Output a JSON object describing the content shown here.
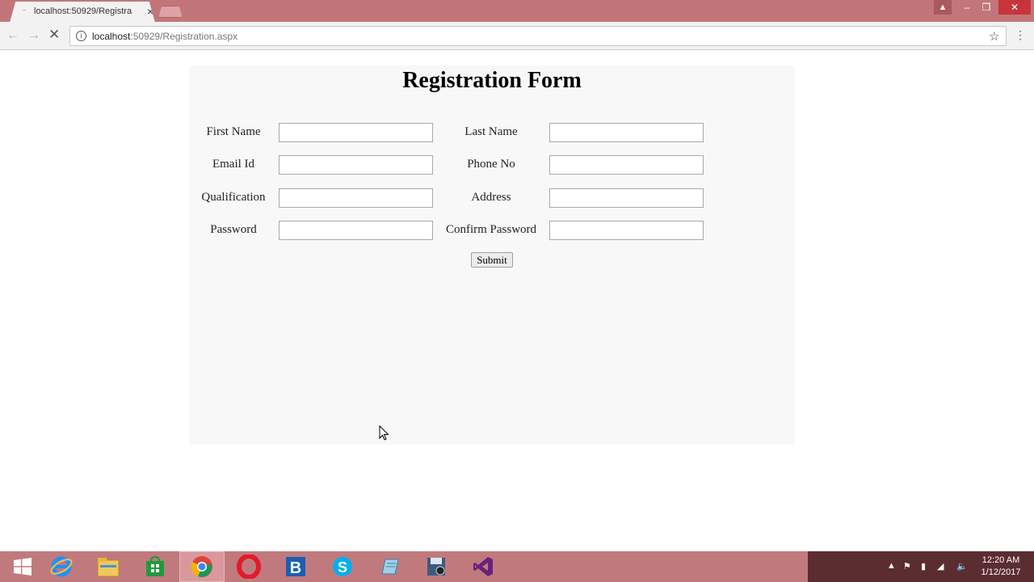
{
  "browser": {
    "tab_title": "localhost:50929/Registra",
    "url_host": "localhost",
    "url_rest": ":50929/Registration.aspx"
  },
  "form": {
    "title": "Registration Form",
    "fields": {
      "first_name": {
        "label": "First Name",
        "value": ""
      },
      "last_name": {
        "label": "Last Name",
        "value": ""
      },
      "email": {
        "label": "Email Id",
        "value": ""
      },
      "phone": {
        "label": "Phone No",
        "value": ""
      },
      "qualification": {
        "label": "Qualification",
        "value": ""
      },
      "address": {
        "label": "Address",
        "value": ""
      },
      "password": {
        "label": "Password",
        "value": ""
      },
      "confirm_password": {
        "label": "Confirm Password",
        "value": ""
      }
    },
    "submit_label": "Submit"
  },
  "taskbar": {
    "apps": [
      "start-icon",
      "internet-explorer-icon",
      "file-explorer-icon",
      "store-icon",
      "chrome-icon",
      "opera-icon",
      "bing-icon",
      "skype-icon",
      "notepad-icon",
      "save-app-icon",
      "visual-studio-icon"
    ],
    "clock_time": "12:20 AM",
    "clock_date": "1/12/2017"
  },
  "colors": {
    "titlebar": "#c2767a",
    "taskbar": "#c07a7e",
    "panel_bg": "#f8f8f8"
  }
}
